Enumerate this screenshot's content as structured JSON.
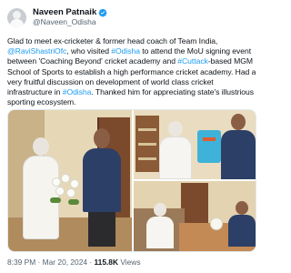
{
  "author": {
    "display_name": "Naveen Patnaik",
    "handle": "@Naveen_Odisha",
    "verified_color": "#1d9bf0"
  },
  "tweet": {
    "segments": [
      {
        "text": "Glad to meet ex-cricketer & former head coach of Team India, ",
        "type": "text"
      },
      {
        "text": "@RaviShastriOfc",
        "type": "mention"
      },
      {
        "text": ", who visited ",
        "type": "text"
      },
      {
        "text": "#Odisha",
        "type": "hashtag"
      },
      {
        "text": " to attend the MoU signing event between 'Coaching Beyond' cricket academy and ",
        "type": "text"
      },
      {
        "text": "#Cuttack",
        "type": "hashtag"
      },
      {
        "text": "-based MGM School of Sports to establish a high performance cricket academy. Had a very fruitful discussion on development of world class cricket infrastructure in ",
        "type": "text"
      },
      {
        "text": "#Odisha",
        "type": "hashtag"
      },
      {
        "text": ". Thanked him for appreciating state's illustrious sporting ecosystem.",
        "type": "text"
      }
    ],
    "link_color": "#1d9bf0"
  },
  "media": {
    "photo_count": 3
  },
  "meta": {
    "time": "8:39 PM",
    "separator": " · ",
    "date": "Mar 20, 2024",
    "views_count": "115.8K",
    "views_label": " Views"
  }
}
